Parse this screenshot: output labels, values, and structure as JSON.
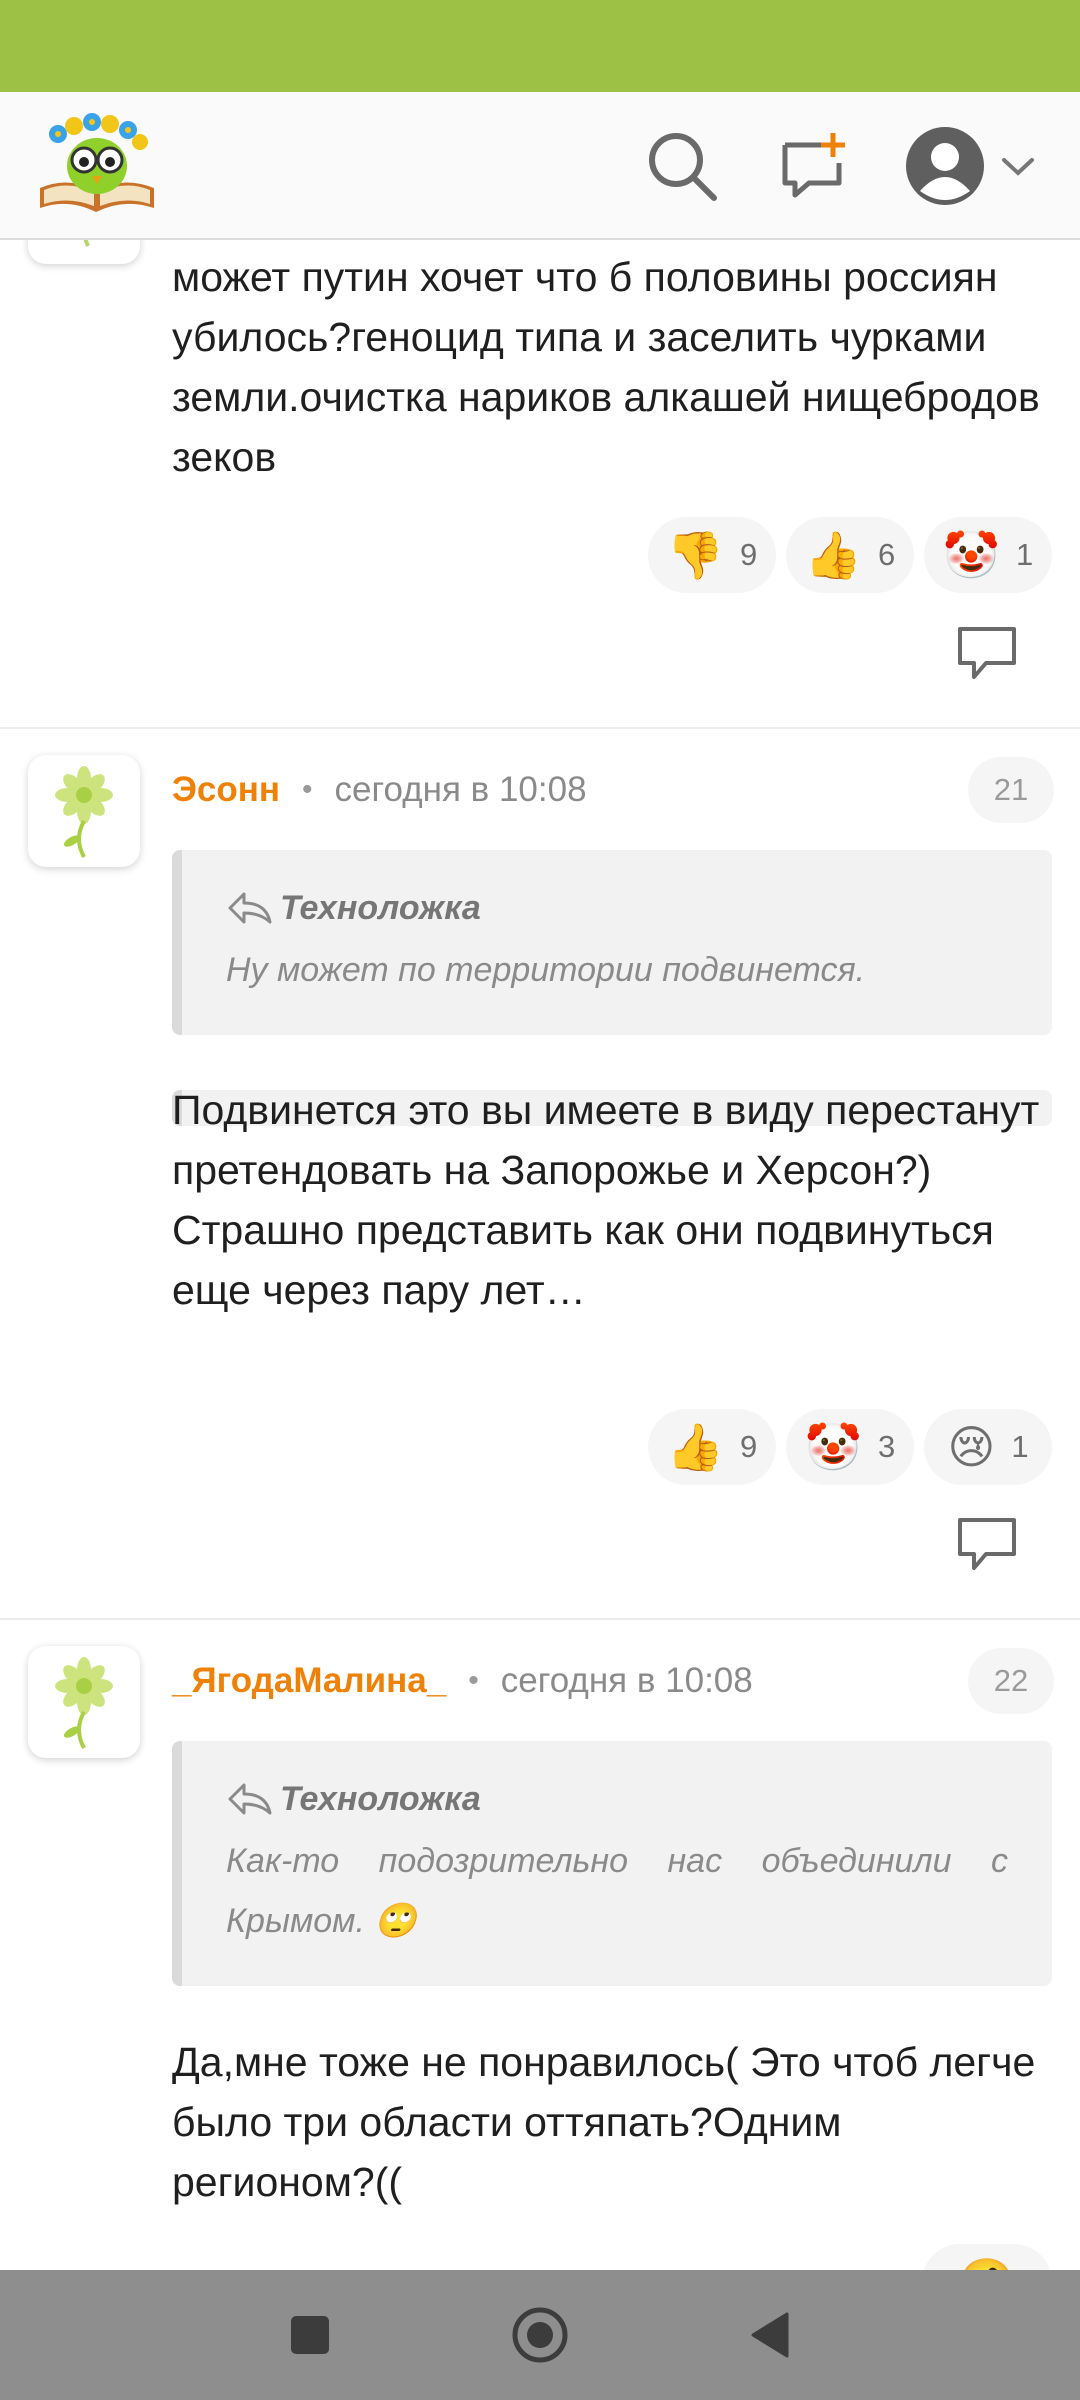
{
  "header": {
    "logo_icon": "book-owl-logo-icon",
    "search_icon": "search-icon",
    "add_icon": "add-message-icon",
    "profile_icon": "user-avatar-icon",
    "dropdown_icon": "chevron-down-icon"
  },
  "colors": {
    "status_bar": "#9dc145",
    "accent_author": "#ee8208"
  },
  "comments": [
    {
      "body": "может путин хочет что б половины россиян убилось?геноцид типа и заселить чурками земли.очистка нариков алкашей нищебродов зеков",
      "reactions": [
        {
          "emoji": "👎",
          "count": "9"
        },
        {
          "emoji": "👍",
          "count": "6"
        },
        {
          "emoji": "🤡",
          "count": "1"
        }
      ]
    },
    {
      "author": "Эсонн",
      "time": "сегодня в 10:08",
      "number": "21",
      "quote_author": "Техноложка",
      "quote_text": "Ну может по территории подвинется.",
      "body": "Подвинется это вы имеете в виду перестанут претендовать на Запорожье и Херсон?)\nСтрашно представить как они подвинуться еще через пару лет…",
      "reactions": [
        {
          "emoji": "👍",
          "count": "9"
        },
        {
          "emoji": "🤡",
          "count": "3"
        },
        {
          "emoji": "😢",
          "count": "1"
        }
      ]
    },
    {
      "author": "_ЯгодаМалина_",
      "time": "сегодня в 10:08",
      "number": "22",
      "quote_author": "Техноложка",
      "quote_text": "Как-то подозрительно нас объединили с Крымом. 🙄",
      "body": "Да,мне тоже не понравилось( Это чтоб легче было три области оттяпать?Одним регионом?(("
    }
  ],
  "navbar": {
    "recents_icon": "square-recents-icon",
    "home_icon": "circle-home-icon",
    "back_icon": "triangle-back-icon"
  }
}
